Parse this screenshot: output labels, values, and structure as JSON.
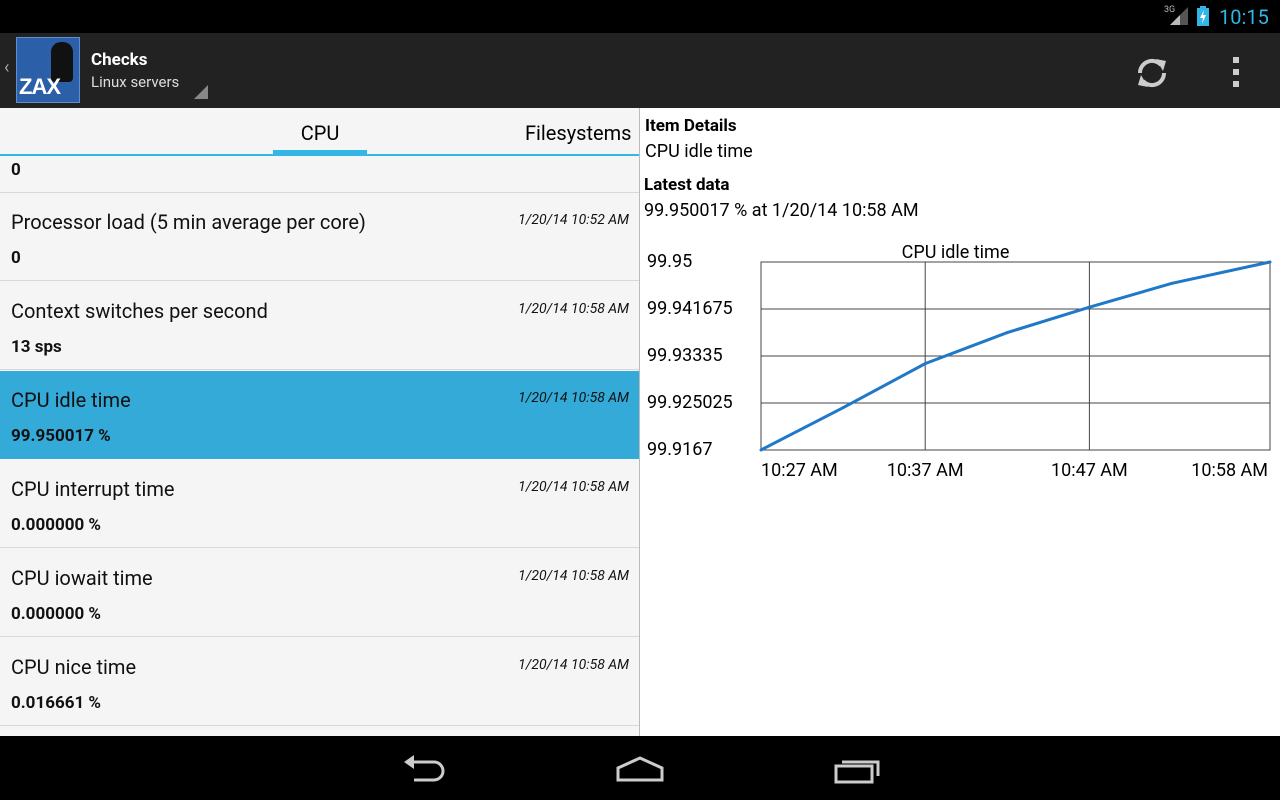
{
  "status_bar": {
    "network": "3G",
    "time": "10:15"
  },
  "action_bar": {
    "title": "Checks",
    "subtitle": "Linux servers",
    "logo_text": "ZAX"
  },
  "tabs": [
    {
      "label": "CPU",
      "selected": true
    },
    {
      "label": "Filesystems",
      "selected": false
    }
  ],
  "items": [
    {
      "name": "",
      "time": "",
      "value": "0"
    },
    {
      "name": "Processor load (5 min average per core)",
      "time": "1/20/14 10:52 AM",
      "value": "0"
    },
    {
      "name": "Context switches per second",
      "time": "1/20/14 10:58 AM",
      "value": "13 sps"
    },
    {
      "name": "CPU idle time",
      "time": "1/20/14 10:58 AM",
      "value": "99.950017 %",
      "selected": true
    },
    {
      "name": "CPU interrupt time",
      "time": "1/20/14 10:58 AM",
      "value": "0.000000 %"
    },
    {
      "name": "CPU iowait time",
      "time": "1/20/14 10:58 AM",
      "value": "0.000000 %"
    },
    {
      "name": "CPU nice time",
      "time": "1/20/14 10:58 AM",
      "value": "0.016661 %"
    }
  ],
  "details": {
    "item_details_heading": "Item Details",
    "item_name": "CPU idle time",
    "latest_data_heading": "Latest data",
    "latest_data": "99.950017 % at 1/20/14 10:58 AM"
  },
  "chart_data": {
    "type": "line",
    "title": "CPU idle time",
    "xlabel": "",
    "ylabel": "",
    "x_ticks": [
      "10:27 AM",
      "10:37 AM",
      "10:47 AM",
      "10:58 AM"
    ],
    "y_ticks": [
      "99.95",
      "99.941675",
      "99.93335",
      "99.925025",
      "99.9167"
    ],
    "ylim": [
      99.9167,
      99.95
    ],
    "grid": true,
    "series": [
      {
        "color": "#1f78c8",
        "x": [
          "10:27 AM",
          "10:32 AM",
          "10:37 AM",
          "10:42 AM",
          "10:47 AM",
          "10:52 AM",
          "10:58 AM"
        ],
        "y": [
          99.9167,
          99.9242,
          99.932,
          99.9375,
          99.942,
          99.9462,
          99.95
        ]
      }
    ]
  },
  "colors": {
    "accent": "#33b5e5",
    "selected_row": "#33aad7",
    "line": "#1f78c8",
    "action_bar": "#222222"
  },
  "nav_icons": [
    "back-icon",
    "home-icon",
    "recents-icon"
  ]
}
